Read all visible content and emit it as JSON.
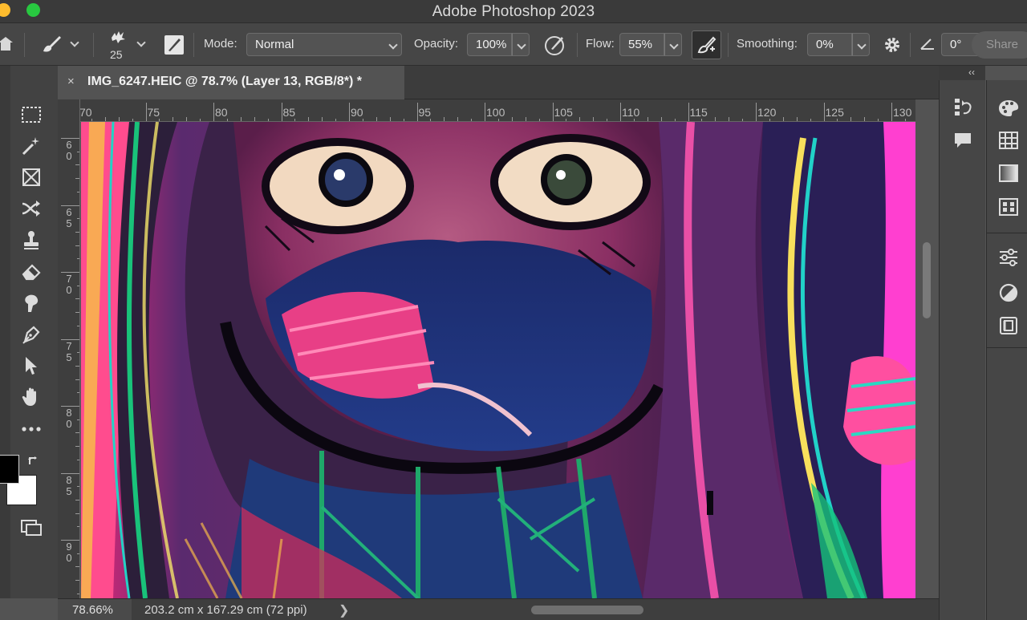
{
  "window": {
    "title": "Adobe Photoshop 2023"
  },
  "options_bar": {
    "brush_size": "25",
    "mode_label": "Mode:",
    "mode_value": "Normal",
    "opacity_label": "Opacity:",
    "opacity_value": "100%",
    "flow_label": "Flow:",
    "flow_value": "55%",
    "smoothing_label": "Smoothing:",
    "smoothing_value": "0%",
    "angle_value": "0°",
    "share_label": "Share"
  },
  "document": {
    "tab_title": "IMG_6247.HEIC @ 78.7% (Layer 13, RGB/8*) *",
    "close_glyph": "×"
  },
  "rulers": {
    "horizontal": [
      "70",
      "75",
      "80",
      "85",
      "90",
      "95",
      "100",
      "105",
      "110",
      "115",
      "120",
      "125",
      "130"
    ],
    "vertical": [
      "60",
      "65",
      "70",
      "75",
      "80",
      "85",
      "90"
    ]
  },
  "status_bar": {
    "zoom": "78.66%",
    "doc_size": "203.2 cm x 167.29 cm (72 ppi)",
    "chevron": "❯"
  },
  "panels": {
    "collapse_glyph": "‹‹"
  },
  "colors": {
    "foreground": "#000000",
    "background": "#ffffff",
    "ui_dark": "#3a3a3a",
    "ui_mid": "#464646",
    "ui_canvas": "#535353"
  }
}
